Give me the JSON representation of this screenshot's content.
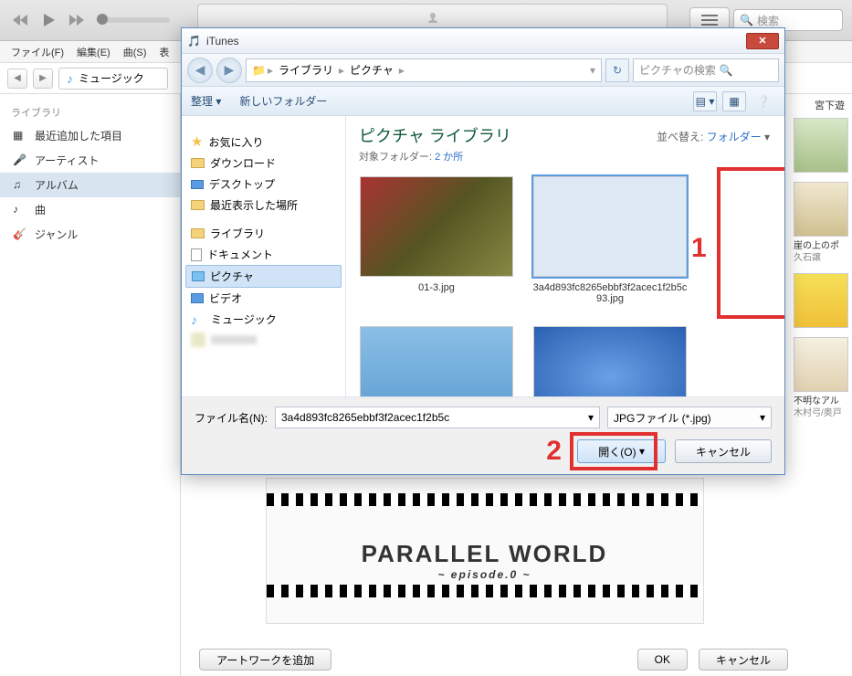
{
  "itunes": {
    "search_placeholder": "検索",
    "menubar": [
      "ファイル(F)",
      "編集(E)",
      "曲(S)",
      "表"
    ],
    "nav_combo": "ミュージック",
    "sidebar_header": "ライブラリ",
    "sidebar_items": [
      {
        "label": "最近追加した項目"
      },
      {
        "label": "アーティスト"
      },
      {
        "label": "アルバム",
        "selected": true
      },
      {
        "label": "曲"
      },
      {
        "label": "ジャンル"
      }
    ],
    "right_header": "宮下遊",
    "right_items": [
      {
        "title": "崖の上のポ",
        "sub": "久石譲"
      },
      {
        "title": "",
        "sub": ""
      },
      {
        "title": "不明なアル",
        "sub": "木村弓/奥戸"
      }
    ],
    "artwork_title": "PARALLEL WORLD",
    "artwork_sub": "~ episode.0 ~",
    "buttons": {
      "add_artwork": "アートワークを追加",
      "ok": "OK",
      "cancel": "キャンセル"
    }
  },
  "dialog": {
    "title": "iTunes",
    "path": [
      "ライブラリ",
      "ピクチャ"
    ],
    "search_placeholder": "ピクチャの検索",
    "toolbar": {
      "organize": "整理",
      "new_folder": "新しいフォルダー"
    },
    "tree": {
      "favorites": "お気に入り",
      "fav_items": [
        "ダウンロード",
        "デスクトップ",
        "最近表示した場所"
      ],
      "libraries": "ライブラリ",
      "lib_items": [
        "ドキュメント",
        "ピクチャ",
        "ビデオ",
        "ミュージック"
      ]
    },
    "files": {
      "header": "ピクチャ ライブラリ",
      "sub_label": "対象フォルダー:",
      "sub_link": "2 か所",
      "sort_label": "並べ替え:",
      "sort_value": "フォルダー",
      "thumbs": [
        {
          "name": "01-3.jpg"
        },
        {
          "name": "3a4d893fc8265ebbf3f2acec1f2b5c93.jpg",
          "selected": true
        }
      ]
    },
    "footer": {
      "file_label": "ファイル名(N):",
      "file_value": "3a4d893fc8265ebbf3f2acec1f2b5c",
      "type_value": "JPGファイル (*.jpg)",
      "open": "開く(O)",
      "cancel": "キャンセル"
    },
    "annotations": {
      "a1": "1",
      "a2": "2"
    }
  }
}
